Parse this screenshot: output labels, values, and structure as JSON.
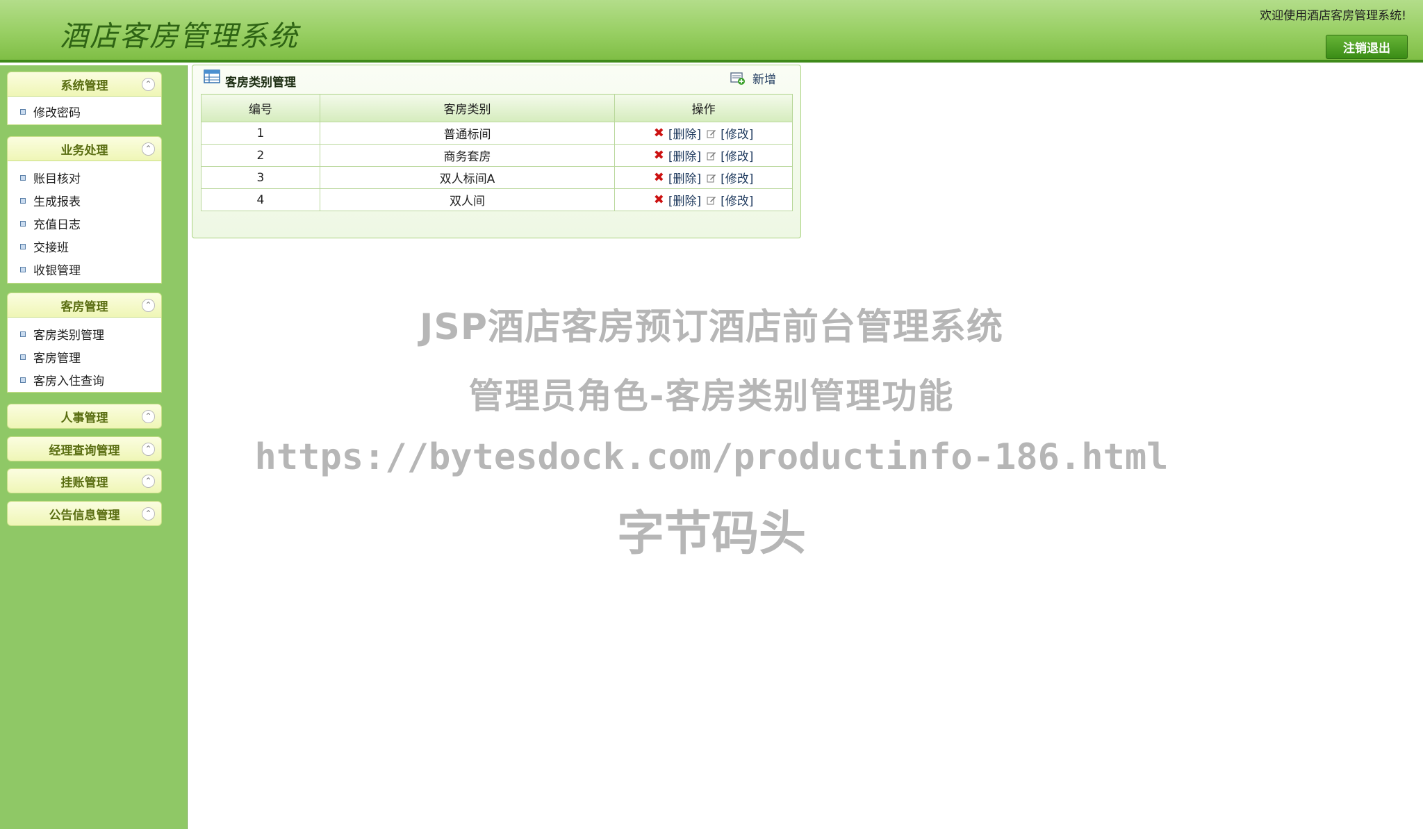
{
  "header": {
    "title": "酒店客房管理系统",
    "welcome": "欢迎使用酒店客房管理系统!",
    "logout_label": "注销退出"
  },
  "sidebar": {
    "groups": [
      {
        "label": "系统管理",
        "items": [
          "修改密码"
        ]
      },
      {
        "label": "业务处理",
        "items": [
          "账目核对",
          "生成报表",
          "充值日志",
          "交接班",
          "收银管理"
        ]
      },
      {
        "label": "客房管理",
        "items": [
          "客房类别管理",
          "客房管理",
          "客房入住查询"
        ]
      },
      {
        "label": "人事管理",
        "items": []
      },
      {
        "label": "经理查询管理",
        "items": []
      },
      {
        "label": "挂账管理",
        "items": []
      },
      {
        "label": "公告信息管理",
        "items": []
      }
    ]
  },
  "panel": {
    "title": "客房类别管理",
    "add_label": "新增",
    "columns": [
      "编号",
      "客房类别",
      "操作"
    ],
    "rows": [
      {
        "id": "1",
        "name": "普通标间"
      },
      {
        "id": "2",
        "name": "商务套房"
      },
      {
        "id": "3",
        "name": "双人标间A"
      },
      {
        "id": "4",
        "name": "双人间"
      }
    ],
    "delete_label": "[删除]",
    "edit_label": "[修改]"
  },
  "watermark": {
    "line1": "JSP酒店客房预订酒店前台管理系统",
    "line2": "管理员角色-客房类别管理功能",
    "line3": "https://bytesdock.com/productinfo-186.html",
    "line4": "字节码头"
  },
  "colors": {
    "header_green": "#98cf63",
    "sidebar_green": "#8fc866",
    "group_header": "#eff6b6",
    "delete_red": "#cc1111",
    "link_blue": "#1f3a5e"
  },
  "icons": {
    "collapse": "double-chevron-up-icon",
    "bullet": "square-bullet-icon",
    "panel": "table-icon",
    "add": "add-record-icon",
    "delete": "x-icon",
    "edit": "pencil-icon"
  }
}
